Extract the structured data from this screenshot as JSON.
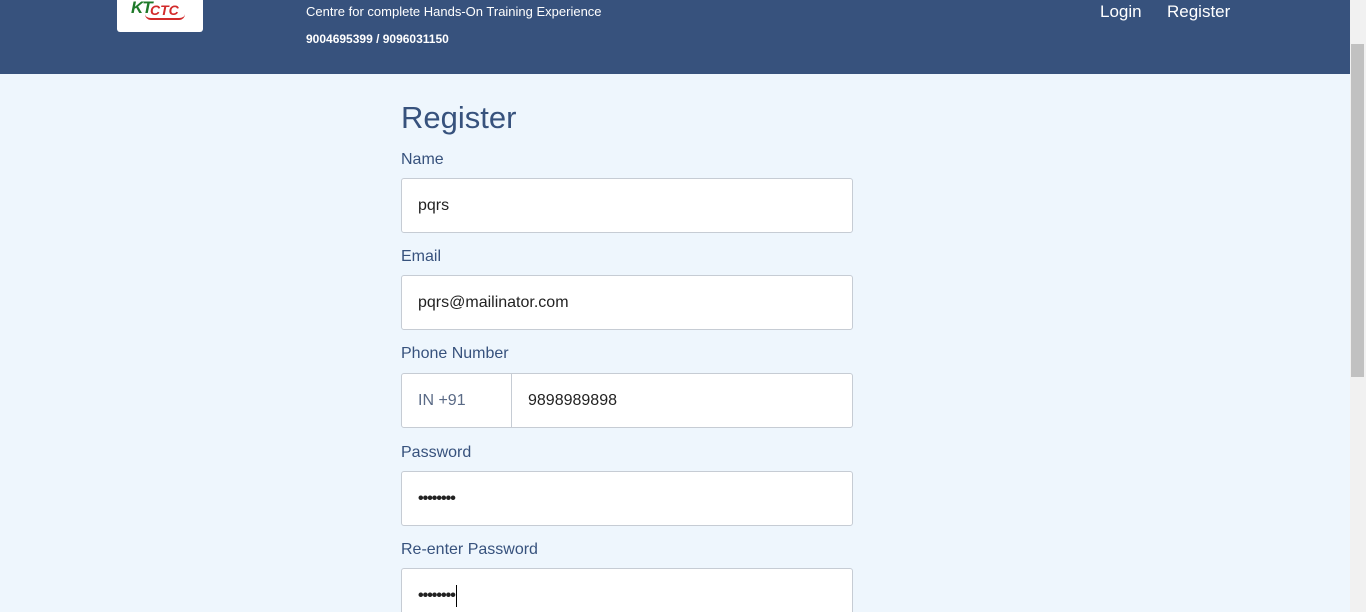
{
  "header": {
    "tagline": "Centre for complete Hands-On Training Experience",
    "phones": "9004695399 / 9096031150",
    "logo": {
      "kt": "KT",
      "ctc": "CTC"
    },
    "nav": {
      "login": "Login",
      "register": "Register"
    },
    "colors": {
      "background": "#37527d",
      "text": "#ffffff"
    }
  },
  "form": {
    "title": "Register",
    "name": {
      "label": "Name",
      "value": "pqrs"
    },
    "email": {
      "label": "Email",
      "value": "pqrs@mailinator.com"
    },
    "phone": {
      "label": "Phone Number",
      "code": "IN +91",
      "value": "9898989898"
    },
    "password": {
      "label": "Password",
      "value": "••••••••"
    },
    "confirm_password": {
      "label": "Re-enter Password",
      "value": "••••••••"
    }
  },
  "colors": {
    "page_bg": "#eef6fd",
    "accent": "#37527d"
  }
}
